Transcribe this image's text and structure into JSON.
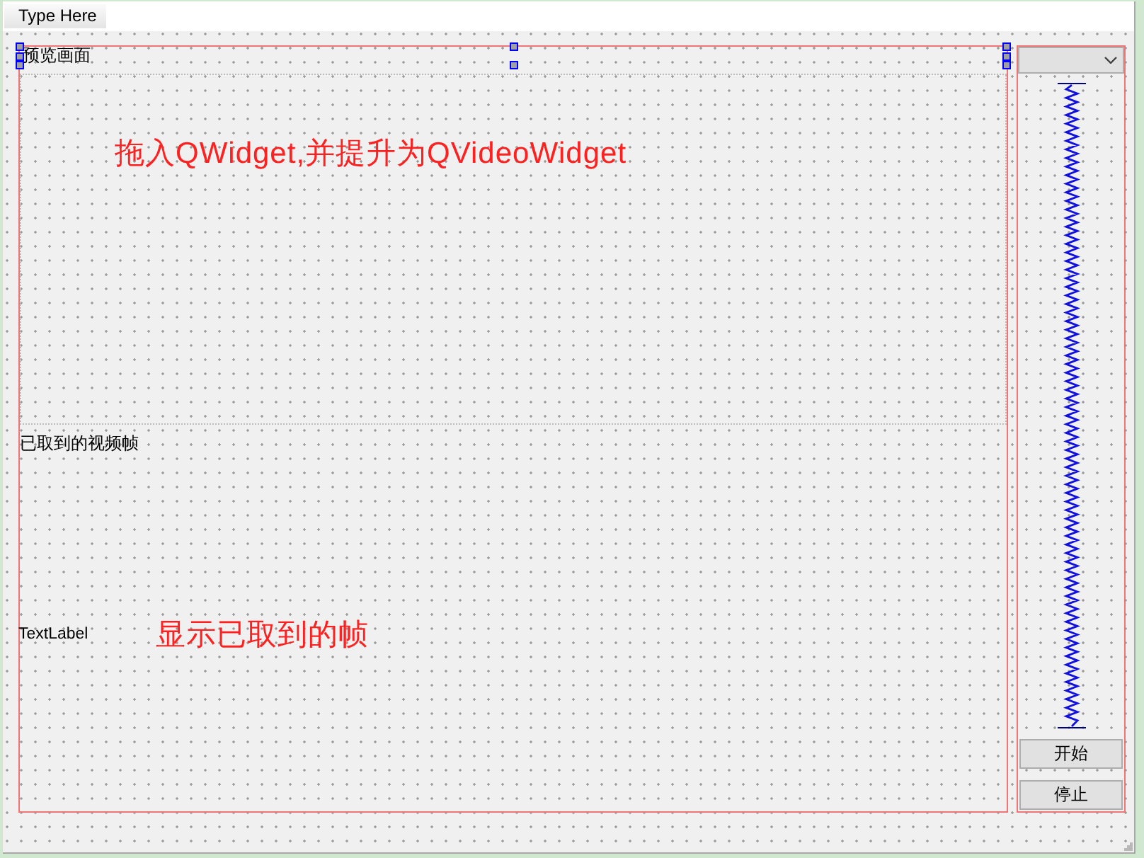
{
  "menu_bar": {
    "item": "Type Here"
  },
  "preview": {
    "label": {
      "text": "预览画面",
      "selected": true
    },
    "note": "拖入QWidget,并提升为QVideoWidget"
  },
  "captured": {
    "label": {
      "text": "已取到的视频帧",
      "selected": false
    },
    "text_label": {
      "text": "TextLabel",
      "selected": false
    },
    "note": "显示已取到的帧"
  },
  "buttons": [
    {
      "label": "开始"
    },
    {
      "label": "停止"
    }
  ]
}
